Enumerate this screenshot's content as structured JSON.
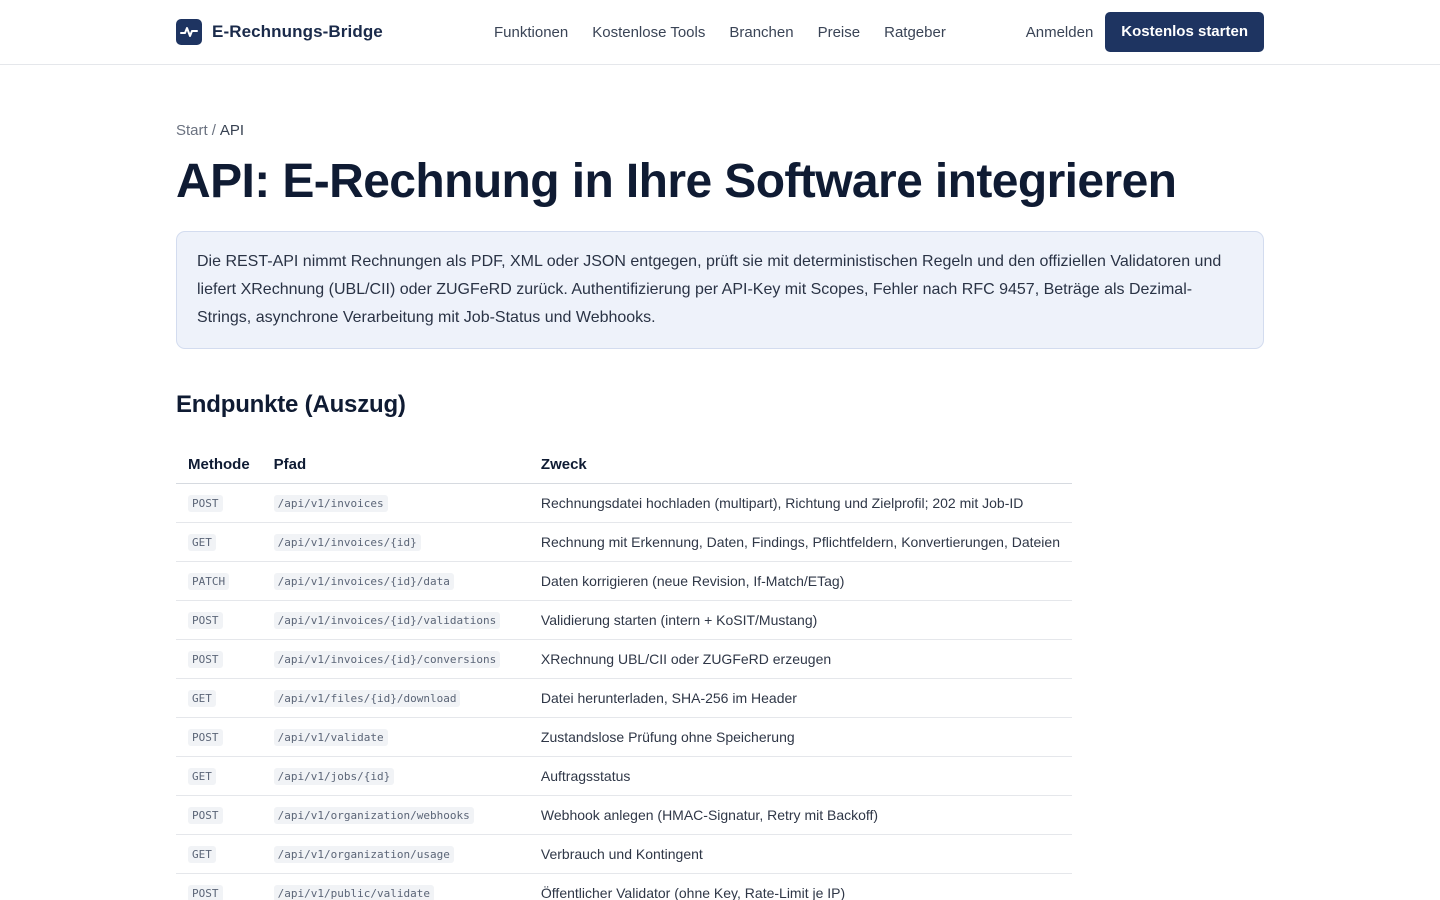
{
  "brand": {
    "name": "E-Rechnungs-Bridge",
    "logo_icon": "pulse-icon",
    "color": "#1e3461"
  },
  "nav": [
    "Funktionen",
    "Kostenlose Tools",
    "Branchen",
    "Preise",
    "Ratgeber"
  ],
  "header_actions": {
    "login": "Anmelden",
    "cta": "Kostenlos starten"
  },
  "breadcrumb": {
    "home": "Start",
    "separator": "/",
    "current": "API"
  },
  "page_title": "API: E-Rechnung in Ihre Software integrieren",
  "intro": "Die REST-API nimmt Rechnungen als PDF, XML oder JSON entgegen, prüft sie mit deterministischen Regeln und den offiziellen Validatoren und liefert XRechnung (UBL/CII) oder ZUGFeRD zurück. Authentifizierung per API-Key mit Scopes, Fehler nach RFC 9457, Beträge als Dezimal-Strings, asynchrone Verarbeitung mit Job-Status und Webhooks.",
  "endpoints_heading": "Endpunkte (Auszug)",
  "table": {
    "headers": [
      "Methode",
      "Pfad",
      "Zweck"
    ],
    "rows": [
      {
        "method": "POST",
        "path": "/api/v1/invoices",
        "purpose": "Rechnungsdatei hochladen (multipart), Richtung und Zielprofil; 202 mit Job-ID"
      },
      {
        "method": "GET",
        "path": "/api/v1/invoices/{id}",
        "purpose": "Rechnung mit Erkennung, Daten, Findings, Pflichtfeldern, Konvertierungen, Dateien"
      },
      {
        "method": "PATCH",
        "path": "/api/v1/invoices/{id}/data",
        "purpose": "Daten korrigieren (neue Revision, If-Match/ETag)"
      },
      {
        "method": "POST",
        "path": "/api/v1/invoices/{id}/validations",
        "purpose": "Validierung starten (intern + KoSIT/Mustang)"
      },
      {
        "method": "POST",
        "path": "/api/v1/invoices/{id}/conversions",
        "purpose": "XRechnung UBL/CII oder ZUGFeRD erzeugen"
      },
      {
        "method": "GET",
        "path": "/api/v1/files/{id}/download",
        "purpose": "Datei herunterladen, SHA-256 im Header"
      },
      {
        "method": "POST",
        "path": "/api/v1/validate",
        "purpose": "Zustandslose Prüfung ohne Speicherung"
      },
      {
        "method": "GET",
        "path": "/api/v1/jobs/{id}",
        "purpose": "Auftragsstatus"
      },
      {
        "method": "POST",
        "path": "/api/v1/organization/webhooks",
        "purpose": "Webhook anlegen (HMAC-Signatur, Retry mit Backoff)"
      },
      {
        "method": "GET",
        "path": "/api/v1/organization/usage",
        "purpose": "Verbrauch und Kontingent"
      },
      {
        "method": "POST",
        "path": "/api/v1/public/validate",
        "purpose": "Öffentlicher Validator (ohne Key, Rate-Limit je IP)"
      }
    ]
  }
}
